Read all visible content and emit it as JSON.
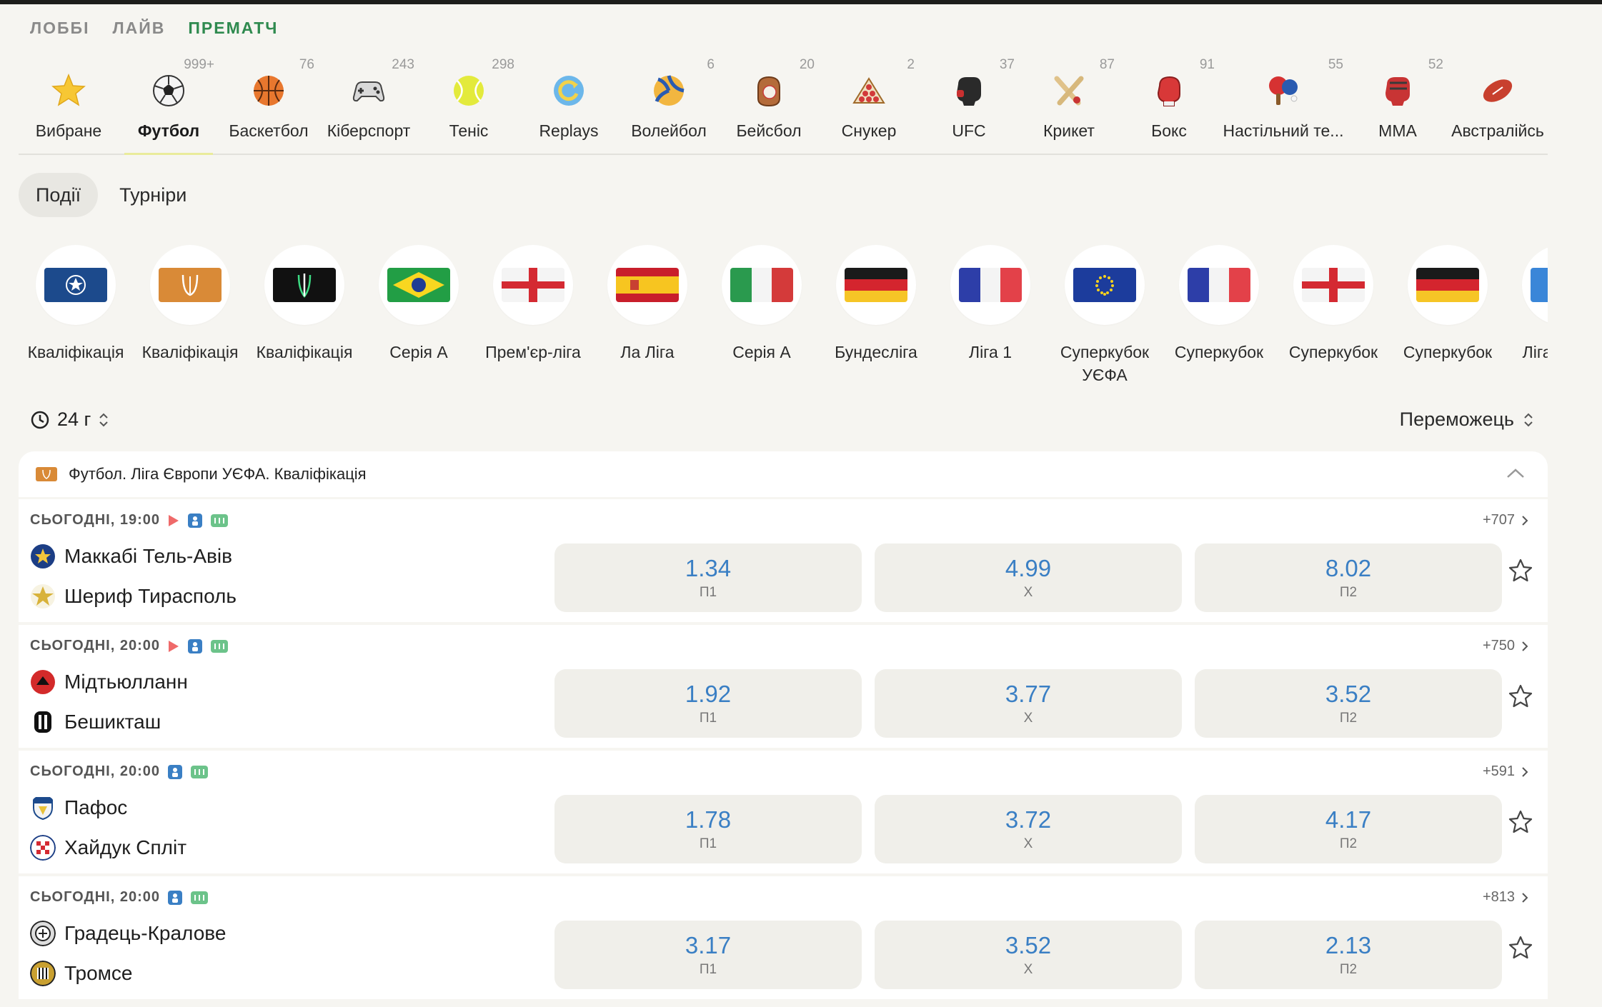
{
  "nav": [
    {
      "label": "ЛОББІ",
      "active": false
    },
    {
      "label": "ЛАЙВ",
      "active": false
    },
    {
      "label": "ПРЕМАТЧ",
      "active": true
    }
  ],
  "sports": [
    {
      "label": "Вибране",
      "count": "",
      "icon": "star-icon"
    },
    {
      "label": "Футбол",
      "count": "999+",
      "icon": "soccer-ball-icon",
      "active": true
    },
    {
      "label": "Баскетбол",
      "count": "76",
      "icon": "basketball-icon"
    },
    {
      "label": "Кіберспорт",
      "count": "243",
      "icon": "gamepad-icon"
    },
    {
      "label": "Теніс",
      "count": "298",
      "icon": "tennis-ball-icon"
    },
    {
      "label": "Replays",
      "count": "",
      "icon": "replay-icon"
    },
    {
      "label": "Волейбол",
      "count": "6",
      "icon": "volleyball-icon"
    },
    {
      "label": "Бейсбол",
      "count": "20",
      "icon": "baseball-glove-icon"
    },
    {
      "label": "Снукер",
      "count": "2",
      "icon": "snooker-icon"
    },
    {
      "label": "UFC",
      "count": "37",
      "icon": "ufc-glove-icon"
    },
    {
      "label": "Крикет",
      "count": "87",
      "icon": "cricket-icon"
    },
    {
      "label": "Бокс",
      "count": "91",
      "icon": "boxing-glove-icon"
    },
    {
      "label": "Настільний те...",
      "count": "55",
      "icon": "table-tennis-icon"
    },
    {
      "label": "MMA",
      "count": "52",
      "icon": "mma-glove-icon"
    },
    {
      "label": "Австралійсь",
      "count": "",
      "icon": "rugby-ball-icon"
    }
  ],
  "subtabs": [
    {
      "label": "Події",
      "active": true
    },
    {
      "label": "Турніри",
      "active": false
    }
  ],
  "leagues": [
    {
      "label": "Кваліфікація",
      "icon": "champions-league-icon"
    },
    {
      "label": "Кваліфікація",
      "icon": "europa-league-icon"
    },
    {
      "label": "Кваліфікація",
      "icon": "conference-league-icon"
    },
    {
      "label": "Серія А",
      "icon": "flag-brazil"
    },
    {
      "label": "Прем'єр-ліга",
      "icon": "flag-england"
    },
    {
      "label": "Ла Ліга",
      "icon": "flag-spain"
    },
    {
      "label": "Серія А",
      "icon": "flag-italy"
    },
    {
      "label": "Бундесліга",
      "icon": "flag-germany"
    },
    {
      "label": "Ліга 1",
      "icon": "flag-france"
    },
    {
      "label": "Суперкубок УЄФА",
      "icon": "flag-eu"
    },
    {
      "label": "Суперкубок",
      "icon": "flag-france"
    },
    {
      "label": "Суперкубок",
      "icon": "flag-england"
    },
    {
      "label": "Суперкубок",
      "icon": "flag-germany"
    },
    {
      "label": "Ліга УЄФА",
      "icon": "uefa-icon"
    }
  ],
  "filter": {
    "time": "24 г",
    "sort": "Переможець"
  },
  "tournament": "Футбол. Ліга Європи УЄФА. Кваліфікація",
  "events": [
    {
      "time": "СЬОГОДНІ, 19:00",
      "stream": true,
      "more": "+707",
      "home": "Маккабі Тель-Авів",
      "away": "Шериф Тирасполь",
      "odds": [
        {
          "v": "1.34",
          "k": "П1"
        },
        {
          "v": "4.99",
          "k": "Х"
        },
        {
          "v": "8.02",
          "k": "П2"
        }
      ]
    },
    {
      "time": "СЬОГОДНІ, 20:00",
      "stream": true,
      "more": "+750",
      "home": "Мідтьюлланн",
      "away": "Бешикташ",
      "odds": [
        {
          "v": "1.92",
          "k": "П1"
        },
        {
          "v": "3.77",
          "k": "Х"
        },
        {
          "v": "3.52",
          "k": "П2"
        }
      ]
    },
    {
      "time": "СЬОГОДНІ, 20:00",
      "stream": false,
      "more": "+591",
      "home": "Пафос",
      "away": "Хайдук Спліт",
      "odds": [
        {
          "v": "1.78",
          "k": "П1"
        },
        {
          "v": "3.72",
          "k": "Х"
        },
        {
          "v": "4.17",
          "k": "П2"
        }
      ]
    },
    {
      "time": "СЬОГОДНІ, 20:00",
      "stream": false,
      "more": "+813",
      "home": "Градець-Кралове",
      "away": "Тромсе",
      "odds": [
        {
          "v": "3.17",
          "k": "П1"
        },
        {
          "v": "3.52",
          "k": "Х"
        },
        {
          "v": "2.13",
          "k": "П2"
        }
      ]
    }
  ]
}
